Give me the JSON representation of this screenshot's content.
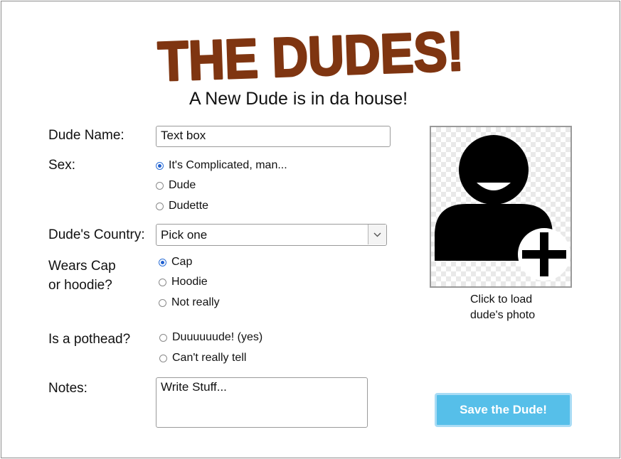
{
  "header": {
    "logo_text": "THE DUDES!",
    "subtitle": "A New Dude is in da house!"
  },
  "form": {
    "name": {
      "label": "Dude Name:",
      "value": "Text box"
    },
    "sex": {
      "label": "Sex:",
      "options": [
        "It's Complicated, man...",
        "Dude",
        "Dudette"
      ],
      "selected": "It's Complicated, man..."
    },
    "country": {
      "label": "Dude's Country:",
      "value": "Pick one"
    },
    "headwear": {
      "label_line1": "Wears Cap",
      "label_line2": "or hoodie?",
      "options": [
        "Cap",
        "Hoodie",
        "Not really"
      ],
      "selected": "Cap"
    },
    "pothead": {
      "label": "Is a pothead?",
      "options": [
        "Duuuuuude! (yes)",
        "Can't really tell"
      ],
      "selected": null
    },
    "notes": {
      "label": "Notes:",
      "value": "Write Stuff..."
    }
  },
  "photo": {
    "icon": "add-user-icon",
    "caption_line1": "Click to load",
    "caption_line2": "dude's photo"
  },
  "actions": {
    "save_label": "Save the Dude!"
  },
  "colors": {
    "logo": "#7f3511",
    "save_button": "#56bfe9",
    "radio_selected": "#1f5fd0"
  }
}
